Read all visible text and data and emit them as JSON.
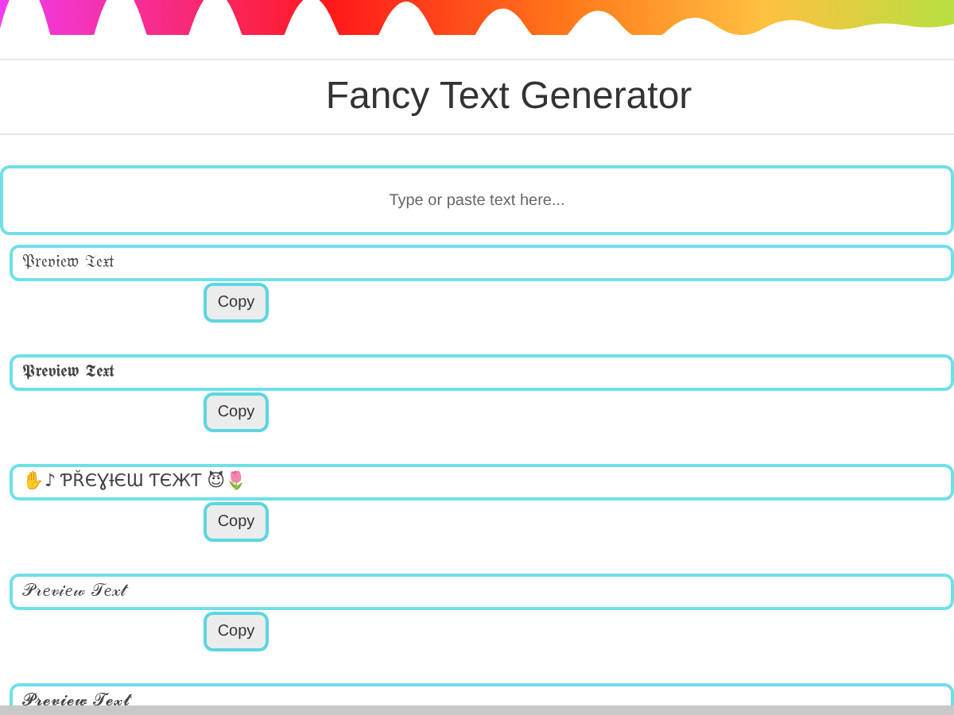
{
  "title": "Fancy Text Generator",
  "input": {
    "placeholder": "Type or paste text here..."
  },
  "results": [
    {
      "text": "𝔓𝔯𝔢𝔳𝔦𝔢𝔴 𝔗𝔢𝔵𝔱",
      "button": "Copy"
    },
    {
      "text": "𝕻𝖗𝖊𝖛𝖎𝖊𝖜 𝕿𝖊𝖝𝖙",
      "button": "Copy"
    },
    {
      "text": "✋♪ ƤŘЄƔƗЄƜ ƬЄЖƬ 😈🌷",
      "button": "Copy"
    },
    {
      "text": "𝒫𝓇𝑒𝓋𝒾𝑒𝓌 𝒯𝑒𝓍𝓉",
      "button": "Copy"
    },
    {
      "text": "𝓟𝓻𝓮𝓿𝓲𝓮𝔀 𝓣𝓮𝔁𝓽"
    }
  ]
}
